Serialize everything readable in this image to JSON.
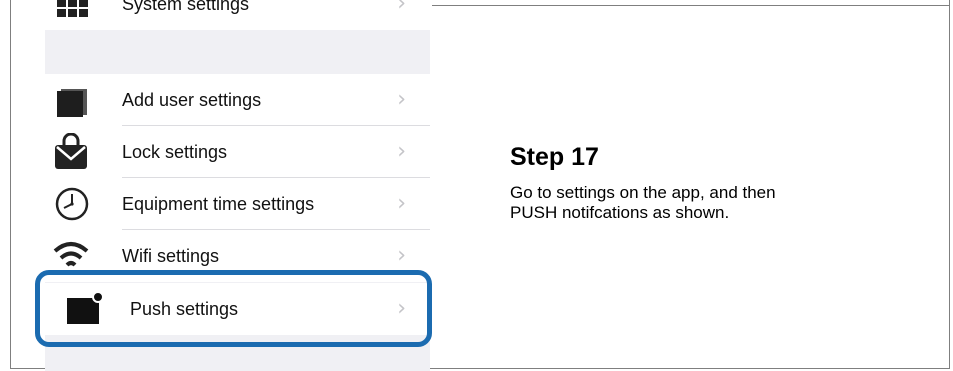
{
  "phone": {
    "items": [
      {
        "label": "System settings",
        "icon": "grid-icon"
      },
      {
        "label": "Add user settings",
        "icon": "user-card-icon"
      },
      {
        "label": "Lock settings",
        "icon": "lock-icon"
      },
      {
        "label": "Equipment time settings",
        "icon": "clock-icon"
      },
      {
        "label": "Wifi settings",
        "icon": "wifi-icon"
      },
      {
        "label": "Push settings",
        "icon": "envelope-icon"
      }
    ],
    "chevron": "›"
  },
  "step": {
    "title": "Step 17",
    "line1": "Go to settings on the app, and then",
    "line2": "PUSH notifcations as shown."
  },
  "colors": {
    "highlight": "#1b6bb0",
    "background": "#f0f0f4"
  }
}
